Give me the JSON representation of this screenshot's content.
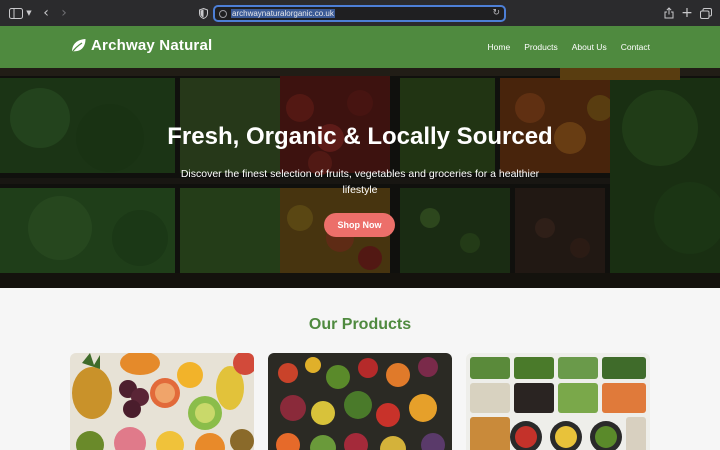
{
  "browser": {
    "url": "archwaynaturalorganic.co.uk"
  },
  "site": {
    "brand": "Archway Natural",
    "nav": [
      "Home",
      "Products",
      "About Us",
      "Contact"
    ]
  },
  "hero": {
    "title": "Fresh, Organic & Locally Sourced",
    "subtitle": "Discover the finest selection of fruits, vegetables and groceries for a healthier lifestyle",
    "cta": "Shop Now"
  },
  "products": {
    "title": "Our Products"
  },
  "colors": {
    "brand_green": "#4f8a3f",
    "cta_coral": "#ec6f6a"
  },
  "icons": [
    "sidebar-icon",
    "chevron-down-icon",
    "back-icon",
    "forward-icon",
    "shield-icon",
    "site-icon",
    "reload-icon",
    "share-icon",
    "new-tab-icon",
    "tabs-overview-icon",
    "leaf-icon"
  ]
}
